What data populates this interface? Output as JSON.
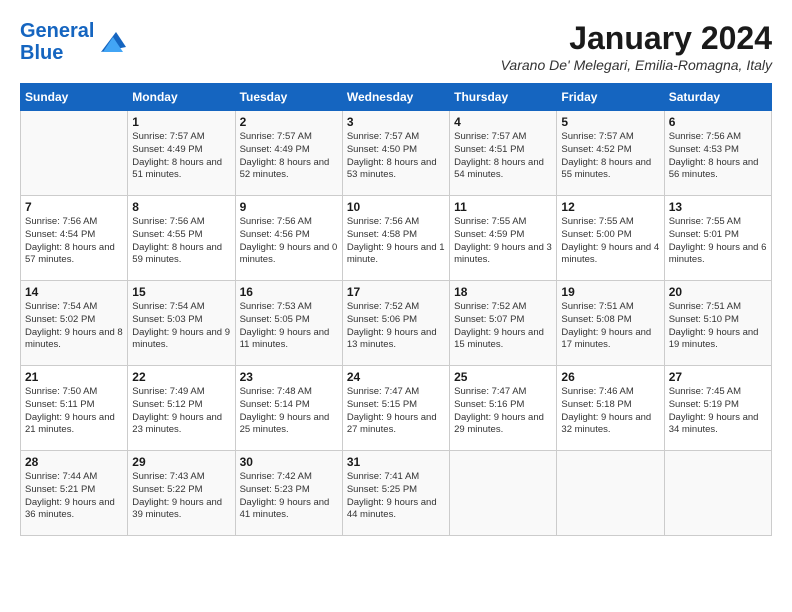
{
  "logo": {
    "line1": "General",
    "line2": "Blue"
  },
  "title": "January 2024",
  "subtitle": "Varano De' Melegari, Emilia-Romagna, Italy",
  "days_of_week": [
    "Sunday",
    "Monday",
    "Tuesday",
    "Wednesday",
    "Thursday",
    "Friday",
    "Saturday"
  ],
  "weeks": [
    [
      {
        "day": "",
        "info": ""
      },
      {
        "day": "1",
        "info": "Sunrise: 7:57 AM\nSunset: 4:49 PM\nDaylight: 8 hours and 51 minutes."
      },
      {
        "day": "2",
        "info": "Sunrise: 7:57 AM\nSunset: 4:49 PM\nDaylight: 8 hours and 52 minutes."
      },
      {
        "day": "3",
        "info": "Sunrise: 7:57 AM\nSunset: 4:50 PM\nDaylight: 8 hours and 53 minutes."
      },
      {
        "day": "4",
        "info": "Sunrise: 7:57 AM\nSunset: 4:51 PM\nDaylight: 8 hours and 54 minutes."
      },
      {
        "day": "5",
        "info": "Sunrise: 7:57 AM\nSunset: 4:52 PM\nDaylight: 8 hours and 55 minutes."
      },
      {
        "day": "6",
        "info": "Sunrise: 7:56 AM\nSunset: 4:53 PM\nDaylight: 8 hours and 56 minutes."
      }
    ],
    [
      {
        "day": "7",
        "info": "Sunrise: 7:56 AM\nSunset: 4:54 PM\nDaylight: 8 hours and 57 minutes."
      },
      {
        "day": "8",
        "info": "Sunrise: 7:56 AM\nSunset: 4:55 PM\nDaylight: 8 hours and 59 minutes."
      },
      {
        "day": "9",
        "info": "Sunrise: 7:56 AM\nSunset: 4:56 PM\nDaylight: 9 hours and 0 minutes."
      },
      {
        "day": "10",
        "info": "Sunrise: 7:56 AM\nSunset: 4:58 PM\nDaylight: 9 hours and 1 minute."
      },
      {
        "day": "11",
        "info": "Sunrise: 7:55 AM\nSunset: 4:59 PM\nDaylight: 9 hours and 3 minutes."
      },
      {
        "day": "12",
        "info": "Sunrise: 7:55 AM\nSunset: 5:00 PM\nDaylight: 9 hours and 4 minutes."
      },
      {
        "day": "13",
        "info": "Sunrise: 7:55 AM\nSunset: 5:01 PM\nDaylight: 9 hours and 6 minutes."
      }
    ],
    [
      {
        "day": "14",
        "info": "Sunrise: 7:54 AM\nSunset: 5:02 PM\nDaylight: 9 hours and 8 minutes."
      },
      {
        "day": "15",
        "info": "Sunrise: 7:54 AM\nSunset: 5:03 PM\nDaylight: 9 hours and 9 minutes."
      },
      {
        "day": "16",
        "info": "Sunrise: 7:53 AM\nSunset: 5:05 PM\nDaylight: 9 hours and 11 minutes."
      },
      {
        "day": "17",
        "info": "Sunrise: 7:52 AM\nSunset: 5:06 PM\nDaylight: 9 hours and 13 minutes."
      },
      {
        "day": "18",
        "info": "Sunrise: 7:52 AM\nSunset: 5:07 PM\nDaylight: 9 hours and 15 minutes."
      },
      {
        "day": "19",
        "info": "Sunrise: 7:51 AM\nSunset: 5:08 PM\nDaylight: 9 hours and 17 minutes."
      },
      {
        "day": "20",
        "info": "Sunrise: 7:51 AM\nSunset: 5:10 PM\nDaylight: 9 hours and 19 minutes."
      }
    ],
    [
      {
        "day": "21",
        "info": "Sunrise: 7:50 AM\nSunset: 5:11 PM\nDaylight: 9 hours and 21 minutes."
      },
      {
        "day": "22",
        "info": "Sunrise: 7:49 AM\nSunset: 5:12 PM\nDaylight: 9 hours and 23 minutes."
      },
      {
        "day": "23",
        "info": "Sunrise: 7:48 AM\nSunset: 5:14 PM\nDaylight: 9 hours and 25 minutes."
      },
      {
        "day": "24",
        "info": "Sunrise: 7:47 AM\nSunset: 5:15 PM\nDaylight: 9 hours and 27 minutes."
      },
      {
        "day": "25",
        "info": "Sunrise: 7:47 AM\nSunset: 5:16 PM\nDaylight: 9 hours and 29 minutes."
      },
      {
        "day": "26",
        "info": "Sunrise: 7:46 AM\nSunset: 5:18 PM\nDaylight: 9 hours and 32 minutes."
      },
      {
        "day": "27",
        "info": "Sunrise: 7:45 AM\nSunset: 5:19 PM\nDaylight: 9 hours and 34 minutes."
      }
    ],
    [
      {
        "day": "28",
        "info": "Sunrise: 7:44 AM\nSunset: 5:21 PM\nDaylight: 9 hours and 36 minutes."
      },
      {
        "day": "29",
        "info": "Sunrise: 7:43 AM\nSunset: 5:22 PM\nDaylight: 9 hours and 39 minutes."
      },
      {
        "day": "30",
        "info": "Sunrise: 7:42 AM\nSunset: 5:23 PM\nDaylight: 9 hours and 41 minutes."
      },
      {
        "day": "31",
        "info": "Sunrise: 7:41 AM\nSunset: 5:25 PM\nDaylight: 9 hours and 44 minutes."
      },
      {
        "day": "",
        "info": ""
      },
      {
        "day": "",
        "info": ""
      },
      {
        "day": "",
        "info": ""
      }
    ]
  ]
}
